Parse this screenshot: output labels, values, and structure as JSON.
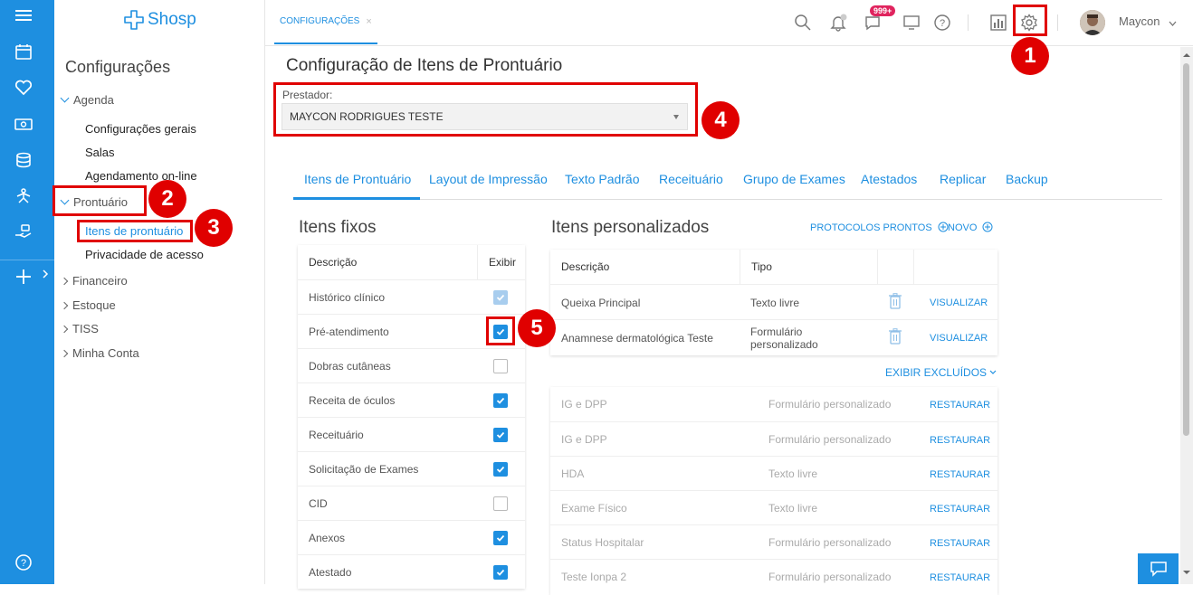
{
  "app": {
    "logo_text": "Shosp",
    "user_name": "Maycon",
    "notification_count": "999+",
    "open_tab": "CONFIGURAÇÕES",
    "close_glyph": "×"
  },
  "rail": {
    "icons": [
      "menu-icon",
      "calendar-icon",
      "heart-icon",
      "money-icon",
      "database-icon",
      "skills-icon",
      "hand-icon",
      "plus-icon"
    ],
    "bottom_icon": "help-icon"
  },
  "sidebar": {
    "title": "Configurações",
    "agenda": {
      "label": "Agenda",
      "items": [
        "Configurações gerais",
        "Salas",
        "Agendamento on-line"
      ]
    },
    "prontuario": {
      "label": "Prontuário",
      "items": [
        "Itens de prontuário",
        "Privacidade de acesso"
      ]
    },
    "collapsed": [
      "Financeiro",
      "Estoque",
      "TISS",
      "Minha Conta"
    ]
  },
  "annotations": [
    "1",
    "2",
    "3",
    "4",
    "5"
  ],
  "page": {
    "title": "Configuração de Itens de Prontuário",
    "prestador_label": "Prestador:",
    "prestador_value": "MAYCON RODRIGUES TESTE",
    "tabs": [
      "Itens de Prontuário",
      "Layout de Impressão",
      "Texto Padrão",
      "Receituário",
      "Grupo de Exames",
      "Atestados",
      "Replicar",
      "Backup"
    ]
  },
  "fixos": {
    "title": "Itens fixos",
    "col_desc": "Descrição",
    "col_exibir": "Exibir",
    "rows": [
      {
        "label": "Histórico clínico",
        "state": "disabled-checked"
      },
      {
        "label": "Pré-atendimento",
        "state": "checked"
      },
      {
        "label": "Dobras cutâneas",
        "state": "unchecked"
      },
      {
        "label": "Receita de óculos",
        "state": "checked"
      },
      {
        "label": "Receituário",
        "state": "checked"
      },
      {
        "label": "Solicitação de Exames",
        "state": "checked"
      },
      {
        "label": "CID",
        "state": "unchecked"
      },
      {
        "label": "Anexos",
        "state": "checked"
      },
      {
        "label": "Atestado",
        "state": "checked"
      }
    ]
  },
  "personalizados": {
    "title": "Itens personalizados",
    "protocolos": "PROTOCOLOS PRONTOS",
    "novo": "NOVO",
    "col_desc": "Descrição",
    "col_tipo": "Tipo",
    "view_label": "VISUALIZAR",
    "rows": [
      {
        "desc": "Queixa Principal",
        "tipo": "Texto livre"
      },
      {
        "desc": "Anamnese dermatológica Teste",
        "tipo": "Formulário personalizado"
      }
    ],
    "exibir_excluidos": "EXIBIR EXCLUÍDOS",
    "restore_label": "RESTAURAR",
    "excluidos": [
      {
        "desc": "IG e DPP",
        "tipo": "Formulário personalizado"
      },
      {
        "desc": "IG e DPP",
        "tipo": "Formulário personalizado"
      },
      {
        "desc": "HDA",
        "tipo": "Texto livre"
      },
      {
        "desc": "Exame Físico",
        "tipo": "Texto livre"
      },
      {
        "desc": "Status Hospitalar",
        "tipo": "Formulário personalizado"
      },
      {
        "desc": "Teste Ionpa 2",
        "tipo": "Formulário personalizado"
      }
    ]
  },
  "colors": {
    "accent": "#1e8fe0",
    "annotation_red": "#e00000",
    "notif_badge": "#e0245e"
  }
}
